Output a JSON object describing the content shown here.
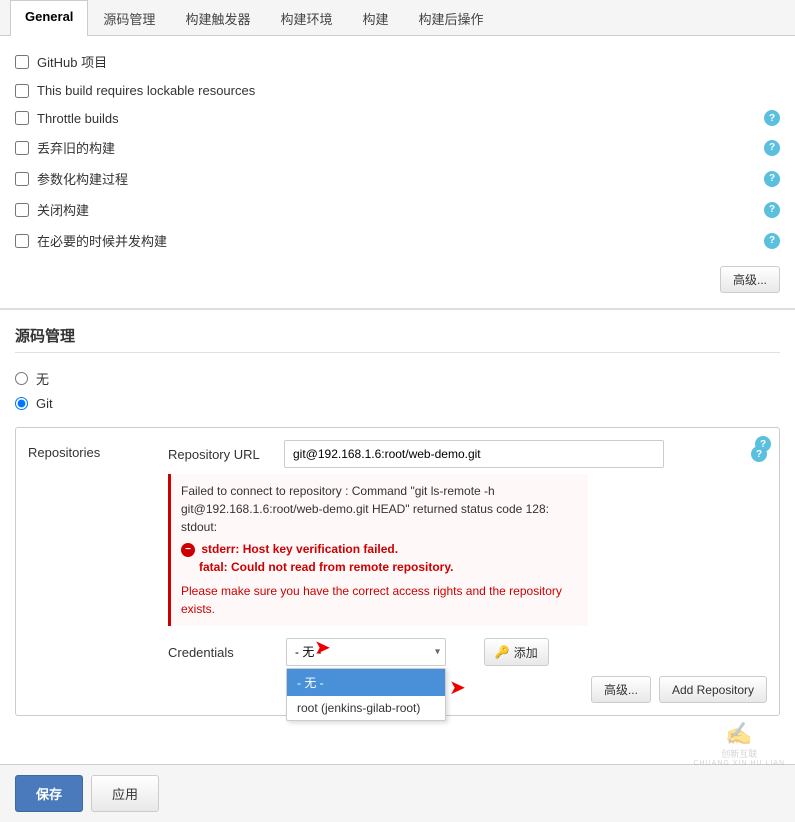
{
  "tabs": [
    {
      "label": "General",
      "active": true
    },
    {
      "label": "源码管理",
      "active": false
    },
    {
      "label": "构建触发器",
      "active": false
    },
    {
      "label": "构建环境",
      "active": false
    },
    {
      "label": "构建",
      "active": false
    },
    {
      "label": "构建后操作",
      "active": false
    }
  ],
  "general": {
    "checkboxes": [
      {
        "label": "GitHub 项目",
        "checked": false,
        "has_help": false
      },
      {
        "label": "This build requires lockable resources",
        "checked": false,
        "has_help": false
      },
      {
        "label": "Throttle builds",
        "checked": false,
        "has_help": true
      },
      {
        "label": "丢弃旧的构建",
        "checked": false,
        "has_help": true
      },
      {
        "label": "参数化构建过程",
        "checked": false,
        "has_help": true
      },
      {
        "label": "关闭构建",
        "checked": false,
        "has_help": true
      },
      {
        "label": "在必要的时候并发构建",
        "checked": false,
        "has_help": true
      }
    ],
    "advanced_btn": "高级..."
  },
  "scm": {
    "title": "源码管理",
    "options": [
      {
        "label": "无",
        "value": "none",
        "checked": true
      },
      {
        "label": "Git",
        "value": "git",
        "checked": true
      }
    ],
    "repos_label": "Repositories",
    "repo_url_label": "Repository URL",
    "repo_url_value": "git@192.168.1.6:root/web-demo.git",
    "repo_url_placeholder": "",
    "error_text1": "Failed to connect to repository : Command \"git ls-remote -h git@192.168.1.6:root/web-demo.git HEAD\" returned status code 128:",
    "error_text2": "stdout:",
    "error_text3": "stderr: Host key verification failed.",
    "error_text4": "fatal: Could not read from remote repository.",
    "error_text5": "Please make sure you have the correct access rights and the repository exists.",
    "credentials_label": "Credentials",
    "credentials_value": "- 无 -",
    "add_credential_btn": "添加",
    "dropdown_items": [
      {
        "label": "- 无 -",
        "selected": true
      },
      {
        "label": "root (jenkins-gilab-root)",
        "selected": false
      }
    ],
    "advanced_btn": "高级...",
    "add_repo_btn": "Add Repository",
    "help_icon": "?",
    "help_color": "#5bc0de"
  },
  "bottom": {
    "save_btn": "保存",
    "apply_btn": "应用"
  },
  "watermark": {
    "text": "创新互联",
    "sub": "CHUANG XIN HU LIAN"
  }
}
